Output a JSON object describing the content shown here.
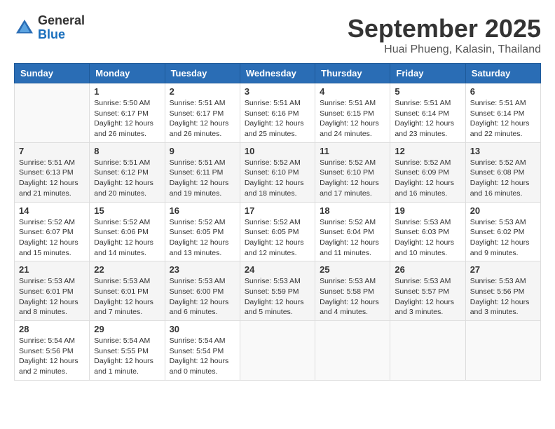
{
  "header": {
    "logo_general": "General",
    "logo_blue": "Blue",
    "month_title": "September 2025",
    "location": "Huai Phueng, Kalasin, Thailand"
  },
  "days_of_week": [
    "Sunday",
    "Monday",
    "Tuesday",
    "Wednesday",
    "Thursday",
    "Friday",
    "Saturday"
  ],
  "weeks": [
    [
      {
        "day": null
      },
      {
        "day": "1",
        "sunrise": "5:50 AM",
        "sunset": "6:17 PM",
        "daylight": "12 hours and 26 minutes."
      },
      {
        "day": "2",
        "sunrise": "5:51 AM",
        "sunset": "6:17 PM",
        "daylight": "12 hours and 26 minutes."
      },
      {
        "day": "3",
        "sunrise": "5:51 AM",
        "sunset": "6:16 PM",
        "daylight": "12 hours and 25 minutes."
      },
      {
        "day": "4",
        "sunrise": "5:51 AM",
        "sunset": "6:15 PM",
        "daylight": "12 hours and 24 minutes."
      },
      {
        "day": "5",
        "sunrise": "5:51 AM",
        "sunset": "6:14 PM",
        "daylight": "12 hours and 23 minutes."
      },
      {
        "day": "6",
        "sunrise": "5:51 AM",
        "sunset": "6:14 PM",
        "daylight": "12 hours and 22 minutes."
      }
    ],
    [
      {
        "day": "7",
        "sunrise": "5:51 AM",
        "sunset": "6:13 PM",
        "daylight": "12 hours and 21 minutes."
      },
      {
        "day": "8",
        "sunrise": "5:51 AM",
        "sunset": "6:12 PM",
        "daylight": "12 hours and 20 minutes."
      },
      {
        "day": "9",
        "sunrise": "5:51 AM",
        "sunset": "6:11 PM",
        "daylight": "12 hours and 19 minutes."
      },
      {
        "day": "10",
        "sunrise": "5:52 AM",
        "sunset": "6:10 PM",
        "daylight": "12 hours and 18 minutes."
      },
      {
        "day": "11",
        "sunrise": "5:52 AM",
        "sunset": "6:10 PM",
        "daylight": "12 hours and 17 minutes."
      },
      {
        "day": "12",
        "sunrise": "5:52 AM",
        "sunset": "6:09 PM",
        "daylight": "12 hours and 16 minutes."
      },
      {
        "day": "13",
        "sunrise": "5:52 AM",
        "sunset": "6:08 PM",
        "daylight": "12 hours and 16 minutes."
      }
    ],
    [
      {
        "day": "14",
        "sunrise": "5:52 AM",
        "sunset": "6:07 PM",
        "daylight": "12 hours and 15 minutes."
      },
      {
        "day": "15",
        "sunrise": "5:52 AM",
        "sunset": "6:06 PM",
        "daylight": "12 hours and 14 minutes."
      },
      {
        "day": "16",
        "sunrise": "5:52 AM",
        "sunset": "6:05 PM",
        "daylight": "12 hours and 13 minutes."
      },
      {
        "day": "17",
        "sunrise": "5:52 AM",
        "sunset": "6:05 PM",
        "daylight": "12 hours and 12 minutes."
      },
      {
        "day": "18",
        "sunrise": "5:52 AM",
        "sunset": "6:04 PM",
        "daylight": "12 hours and 11 minutes."
      },
      {
        "day": "19",
        "sunrise": "5:53 AM",
        "sunset": "6:03 PM",
        "daylight": "12 hours and 10 minutes."
      },
      {
        "day": "20",
        "sunrise": "5:53 AM",
        "sunset": "6:02 PM",
        "daylight": "12 hours and 9 minutes."
      }
    ],
    [
      {
        "day": "21",
        "sunrise": "5:53 AM",
        "sunset": "6:01 PM",
        "daylight": "12 hours and 8 minutes."
      },
      {
        "day": "22",
        "sunrise": "5:53 AM",
        "sunset": "6:01 PM",
        "daylight": "12 hours and 7 minutes."
      },
      {
        "day": "23",
        "sunrise": "5:53 AM",
        "sunset": "6:00 PM",
        "daylight": "12 hours and 6 minutes."
      },
      {
        "day": "24",
        "sunrise": "5:53 AM",
        "sunset": "5:59 PM",
        "daylight": "12 hours and 5 minutes."
      },
      {
        "day": "25",
        "sunrise": "5:53 AM",
        "sunset": "5:58 PM",
        "daylight": "12 hours and 4 minutes."
      },
      {
        "day": "26",
        "sunrise": "5:53 AM",
        "sunset": "5:57 PM",
        "daylight": "12 hours and 3 minutes."
      },
      {
        "day": "27",
        "sunrise": "5:53 AM",
        "sunset": "5:56 PM",
        "daylight": "12 hours and 3 minutes."
      }
    ],
    [
      {
        "day": "28",
        "sunrise": "5:54 AM",
        "sunset": "5:56 PM",
        "daylight": "12 hours and 2 minutes."
      },
      {
        "day": "29",
        "sunrise": "5:54 AM",
        "sunset": "5:55 PM",
        "daylight": "12 hours and 1 minute."
      },
      {
        "day": "30",
        "sunrise": "5:54 AM",
        "sunset": "5:54 PM",
        "daylight": "12 hours and 0 minutes."
      },
      {
        "day": null
      },
      {
        "day": null
      },
      {
        "day": null
      },
      {
        "day": null
      }
    ]
  ]
}
